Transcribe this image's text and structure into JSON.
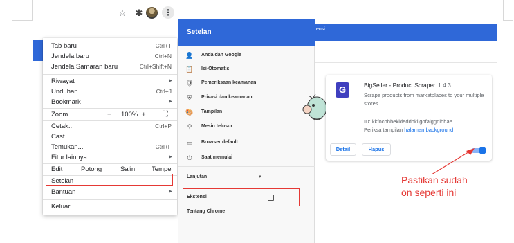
{
  "menu": {
    "items": [
      {
        "label": "Tab baru",
        "shortcut": "Ctrl+T"
      },
      {
        "label": "Jendela baru",
        "shortcut": "Ctrl+N"
      },
      {
        "label": "Jendela Samaran baru",
        "shortcut": "Ctrl+Shift+N"
      },
      {
        "label": "Riwayat",
        "arrow": "▶"
      },
      {
        "label": "Unduhan",
        "shortcut": "Ctrl+J"
      },
      {
        "label": "Bookmark",
        "arrow": "▶"
      },
      {
        "label": "Cetak...",
        "shortcut": "Ctrl+P"
      },
      {
        "label": "Cast..."
      },
      {
        "label": "Temukan...",
        "shortcut": "Ctrl+F"
      },
      {
        "label": "Fitur lainnya",
        "arrow": "▶"
      },
      {
        "label": "Setelan"
      },
      {
        "label": "Bantuan",
        "arrow": "▶"
      },
      {
        "label": "Keluar"
      }
    ],
    "zoom": {
      "label": "Zoom",
      "minus": "−",
      "value": "100%",
      "plus": "+",
      "fullscreen": "⛶"
    },
    "edit": {
      "label": "Edit",
      "cut": "Potong",
      "copy": "Salin",
      "paste": "Tempel"
    }
  },
  "settings": {
    "title": "Setelan",
    "items": [
      {
        "icon": "person-icon",
        "glyph": "👤",
        "label": "Anda dan Google"
      },
      {
        "icon": "clipboard-icon",
        "glyph": "📋",
        "label": "Isi-Otomatis"
      },
      {
        "icon": "shield-check-icon",
        "glyph": "🛡",
        "label": "Pemeriksaan keamanan"
      },
      {
        "icon": "shield-icon",
        "glyph": "⛨",
        "label": "Privasi dan keamanan"
      },
      {
        "icon": "palette-icon",
        "glyph": "🎨",
        "label": "Tampilan"
      },
      {
        "icon": "search-icon",
        "glyph": "⚲",
        "label": "Mesin telusur"
      },
      {
        "icon": "browser-icon",
        "glyph": "▭",
        "label": "Browser default"
      },
      {
        "icon": "power-icon",
        "glyph": "⏻",
        "label": "Saat memulai"
      }
    ],
    "advanced": "Lanjutan",
    "advanced_arrow": "▾",
    "extensions": "Ekstensi",
    "about": "Tentang Chrome"
  },
  "extension": {
    "topbar_fragment": "ensi",
    "logo_letter": "G",
    "name": "BigSeller - Product Scraper",
    "version": "1.4.3",
    "description": "Scrape products from marketplaces to your multiple stores.",
    "id": "ID: kkfocohhekldeddhkllgofalggnlhhae",
    "inspect_prefix": "Periksa tampilan",
    "inspect_link": "halaman background",
    "details_button": "Detail",
    "remove_button": "Hapus",
    "enabled": true
  },
  "annotation": {
    "line1": "Pastikan sudah",
    "line2": "on seperti ini"
  },
  "colors": {
    "accent": "#2f68d8",
    "highlight": "#e53935",
    "link": "#1a73e8"
  }
}
